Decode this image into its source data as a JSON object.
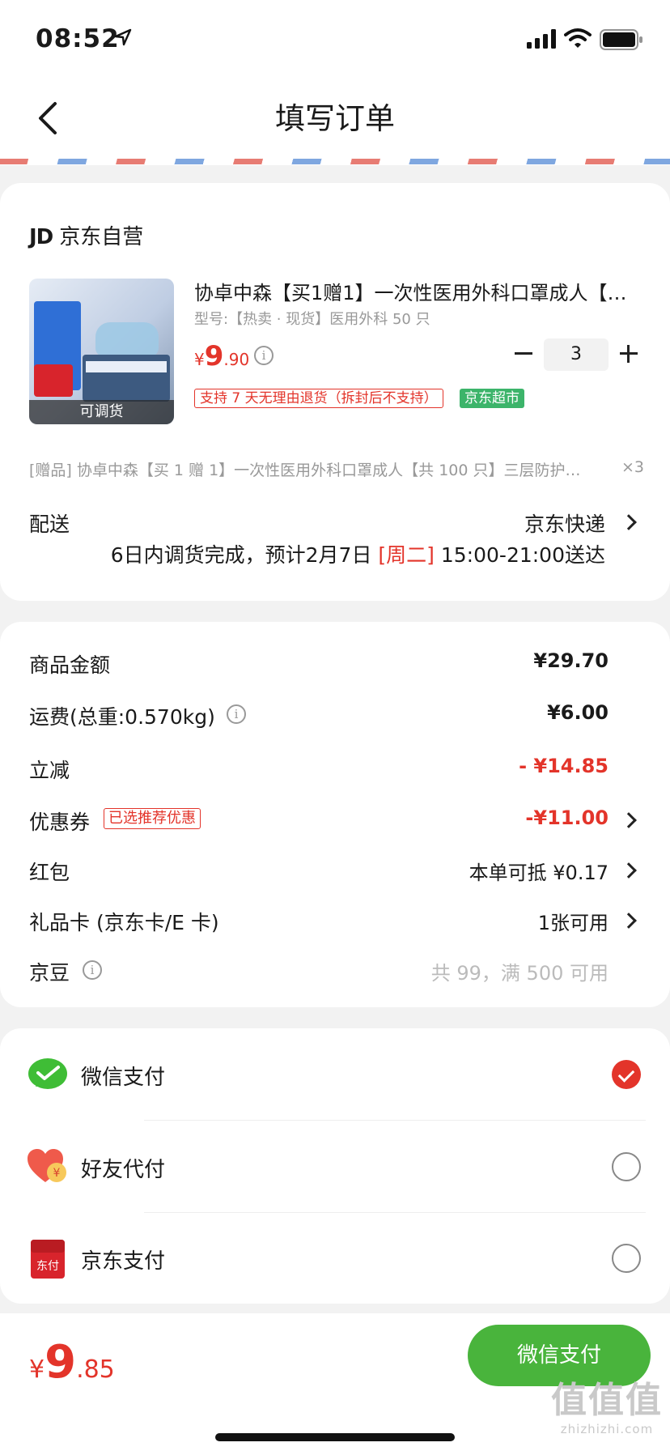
{
  "status_bar": {
    "time": "08:52"
  },
  "nav": {
    "title": "填写订单"
  },
  "shop": {
    "logo_text": "JD",
    "name": "京东自营"
  },
  "product": {
    "image_badge": "可调货",
    "title": "协卓中森【买1赠1】一次性医用外科口罩成人【共100只】三层防护…",
    "spec": "型号:【热卖 · 现货】医用外科 50 只",
    "price_currency": "¥",
    "price_int": "9",
    "price_dec": ".90",
    "quantity": "3",
    "tag_return": "支持 7 天无理由退货（拆封后不支持）",
    "tag_market": "京东超市"
  },
  "gift": {
    "text": "[赠品] 协卓中森【买 1 赠 1】一次性医用外科口罩成人【共 100 只】三层防护…",
    "qty": "×3"
  },
  "delivery": {
    "label": "配送",
    "method": "京东快递",
    "time_prefix": "6日内调货完成，预计2月7日",
    "time_weekday": "[周二]",
    "time_suffix": "15:00-21:00送达"
  },
  "price_rows": {
    "goods_label": "商品金额",
    "goods_value": "¥29.70",
    "freight_label": "运费(总重:0.570kg)",
    "freight_value": "¥6.00",
    "discount_label": "立减",
    "discount_value": "- ¥14.85",
    "coupon_label": "优惠券",
    "coupon_tag": "已选推荐优惠",
    "coupon_value": "-¥11.00",
    "redpacket_label": "红包",
    "redpacket_value": "本单可抵 ¥0.17",
    "giftcard_label": "礼品卡 (京东卡/E 卡)",
    "giftcard_value": "1张可用",
    "jingdou_label": "京豆",
    "jingdou_value": "共 99，满 500 可用"
  },
  "payment": {
    "wechat_label": "微信支付",
    "friend_label": "好友代付",
    "friend_icon_text": "¥",
    "jdpay_label": "京东支付",
    "jdpay_icon_text": "东付",
    "selected": "wechat"
  },
  "bottom": {
    "total_currency": "¥",
    "total_int": "9",
    "total_dec": ".85",
    "pay_button": "微信支付",
    "watermark_big": "值值值",
    "watermark_small": "zhizhizhi.com"
  },
  "colors": {
    "accent_red": "#e3342a",
    "pay_green": "#49b43c",
    "wechat_green": "#3fbd36"
  }
}
